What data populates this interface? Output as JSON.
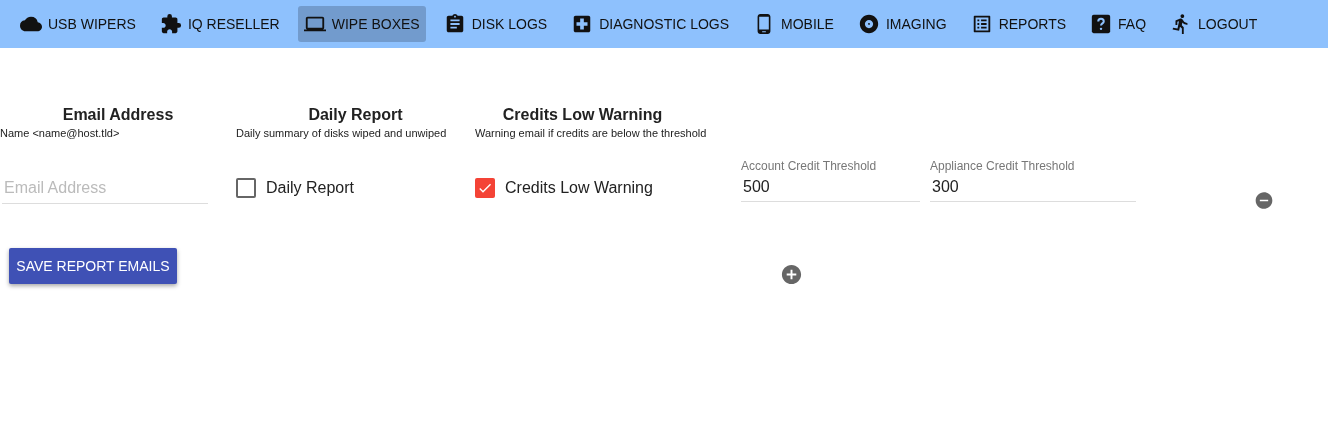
{
  "nav": [
    {
      "label": "USB WIPERS",
      "selected": false
    },
    {
      "label": "IQ RESELLER",
      "selected": false
    },
    {
      "label": "WIPE BOXES",
      "selected": true
    },
    {
      "label": "DISK LOGS",
      "selected": false
    },
    {
      "label": "DIAGNOSTIC LOGS",
      "selected": false
    },
    {
      "label": "MOBILE",
      "selected": false
    },
    {
      "label": "IMAGING",
      "selected": false
    },
    {
      "label": "REPORTS",
      "selected": false
    },
    {
      "label": "FAQ",
      "selected": false
    },
    {
      "label": "LOGOUT",
      "selected": false
    }
  ],
  "columns": [
    {
      "title": "Email Address",
      "subtitle": "Name <name@host.tld>"
    },
    {
      "title": "Daily Report",
      "subtitle": "Daily summary of disks wiped and unwiped"
    },
    {
      "title": "Credits Low Warning",
      "subtitle": "Warning email if credits are below the threshold"
    }
  ],
  "rows": [
    {
      "email": {
        "placeholder": "Email Address"
      },
      "daily_report": {
        "label": "Daily Report",
        "checked": false
      },
      "credits_low": {
        "label": "Credits Low Warning",
        "checked": true
      },
      "account_threshold": {
        "label": "Account Credit Threshold",
        "value": "500"
      },
      "appliance_threshold": {
        "label": "Appliance Credit Threshold",
        "value": "300"
      }
    }
  ],
  "save_button": "SAVE REPORT EMAILS"
}
